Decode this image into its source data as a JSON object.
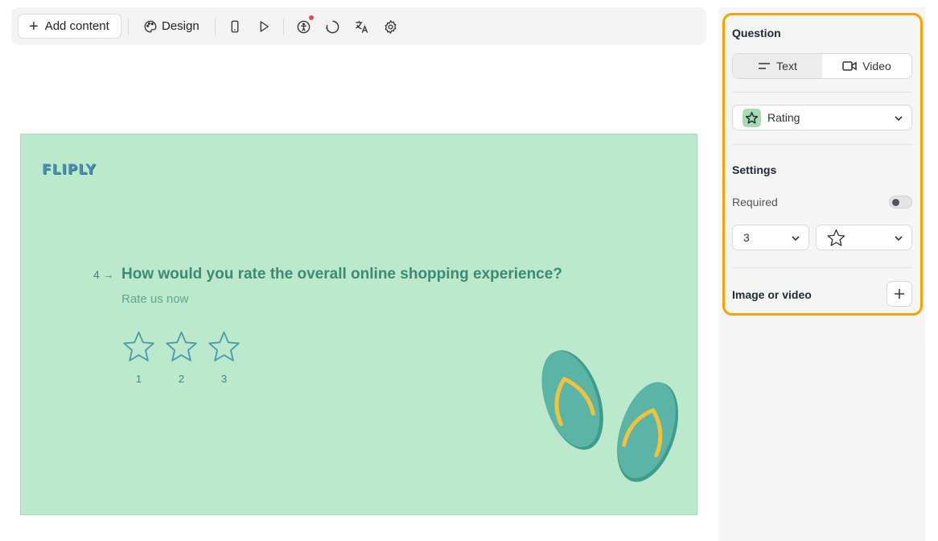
{
  "toolbar": {
    "add_content_label": "Add content",
    "design_label": "Design",
    "icons": [
      "mobile-preview-icon",
      "play-icon",
      "accessibility-icon",
      "loading-icon",
      "translate-icon",
      "settings-gear-icon"
    ]
  },
  "canvas": {
    "logo_text": "FLIPLY",
    "question_number": "4",
    "question_title": "How would you rate the overall online shopping experience?",
    "question_subtitle": "Rate us now",
    "rating_labels": [
      "1",
      "2",
      "3"
    ],
    "background_color": "#bce8cc",
    "accent_color": "#3b8a78"
  },
  "panel": {
    "question_heading": "Question",
    "text_option": "Text",
    "video_option": "Video",
    "question_type": "Rating",
    "settings_heading": "Settings",
    "required_label": "Required",
    "required": false,
    "scale_value": "3",
    "shape_icon": "star-icon",
    "media_heading": "Image or video",
    "highlight_color": "#f5a300"
  }
}
